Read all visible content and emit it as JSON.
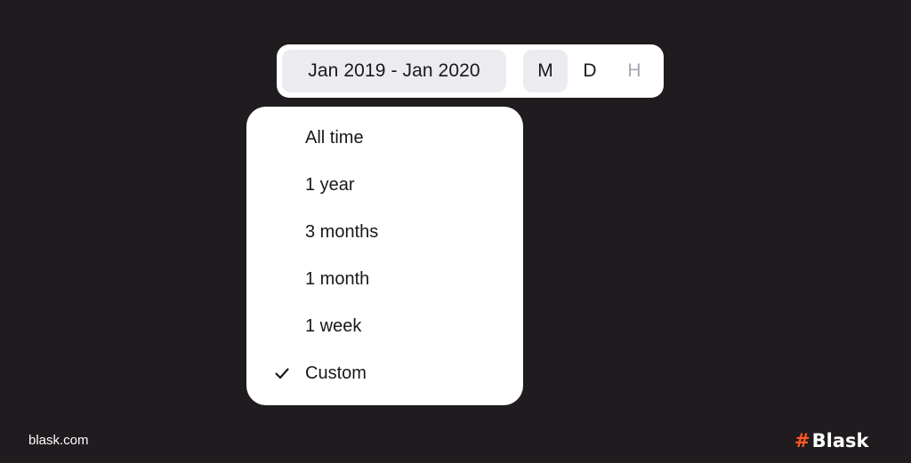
{
  "toolbar": {
    "date_range": "Jan 2019 - Jan 2020",
    "granularity": [
      {
        "label": "M",
        "state": "active"
      },
      {
        "label": "D",
        "state": "normal"
      },
      {
        "label": "H",
        "state": "disabled"
      }
    ]
  },
  "dropdown": {
    "items": [
      {
        "label": "All time",
        "selected": false
      },
      {
        "label": "1 year",
        "selected": false
      },
      {
        "label": "3 months",
        "selected": false
      },
      {
        "label": "1 month",
        "selected": false
      },
      {
        "label": "1 week",
        "selected": false
      },
      {
        "label": "Custom",
        "selected": true
      }
    ],
    "check_icon": "checkmark-icon"
  },
  "footer": {
    "site": "blask.com",
    "brand_mark": "#",
    "brand_name": "Blask"
  },
  "colors": {
    "background": "#1f1b1f",
    "panel": "#ffffff",
    "chip": "#ececf0",
    "text": "#1a171c",
    "disabled_text": "#a8a6b4",
    "brand_accent": "#ff5a1f"
  }
}
